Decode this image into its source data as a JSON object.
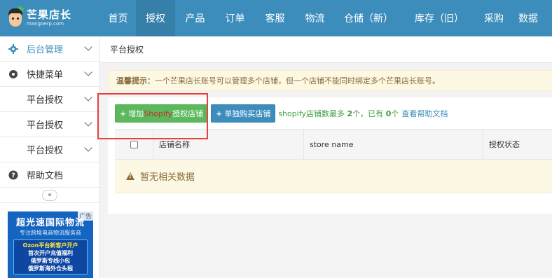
{
  "brand": {
    "name": "芒果店长",
    "sub": "mangoerp.com"
  },
  "nav": {
    "items": [
      {
        "label": "首页",
        "active": false
      },
      {
        "label": "授权",
        "active": true
      },
      {
        "label": "产品",
        "active": false
      },
      {
        "label": "订单",
        "active": false
      },
      {
        "label": "客服",
        "active": false
      },
      {
        "label": "物流",
        "active": false
      },
      {
        "label": "仓储（新）",
        "active": false
      },
      {
        "label": "库存（旧）",
        "active": false
      },
      {
        "label": "采购",
        "active": false
      },
      {
        "label": "数据",
        "active": false
      }
    ]
  },
  "sidebar": {
    "items": [
      {
        "label": "后台管理",
        "icon": "gear-icon"
      },
      {
        "label": "快捷菜单",
        "icon": "disc-icon"
      },
      {
        "label": "平台授权"
      },
      {
        "label": "平台授权"
      },
      {
        "label": "平台授权"
      },
      {
        "label": "帮助文档",
        "icon": "question-icon"
      }
    ],
    "collapse_glyph": "«",
    "ad": {
      "tag": "广告",
      "title": "超光速国际物流",
      "subtitle": "专注跨境电商物流服务商",
      "line1": "Ozon平台新客户开户",
      "line2": "首次开户充值福利",
      "line3": "俄罗斯专线小包",
      "line4": "俄罗斯海外仓头程"
    }
  },
  "breadcrumb": "平台授权",
  "tip": {
    "label": "温馨提示：",
    "text": "一个芒果店长账号可以管理多个店铺，但一个店铺不能同时绑定多个芒果店长账号。"
  },
  "toolbar": {
    "add_prefix": "增加",
    "add_platform": "Shopify",
    "add_suffix": "授权店铺",
    "buy_label": "单独购买店铺",
    "info_prefix": "shopify店铺数最多",
    "info_max": "2",
    "info_mid": "个，已有",
    "info_have": "0",
    "info_suffix": "个",
    "help_link": "查看帮助文档"
  },
  "table": {
    "columns": [
      "店铺名称",
      "store name",
      "授权状态"
    ],
    "empty_text": "暂无相关数据"
  },
  "colors": {
    "topbar": "#3c8dbc",
    "active_nav": "#367fa9",
    "add_button": "#5cb85c",
    "buy_button": "#3c8dbc",
    "highlight_frame": "#e84040"
  }
}
